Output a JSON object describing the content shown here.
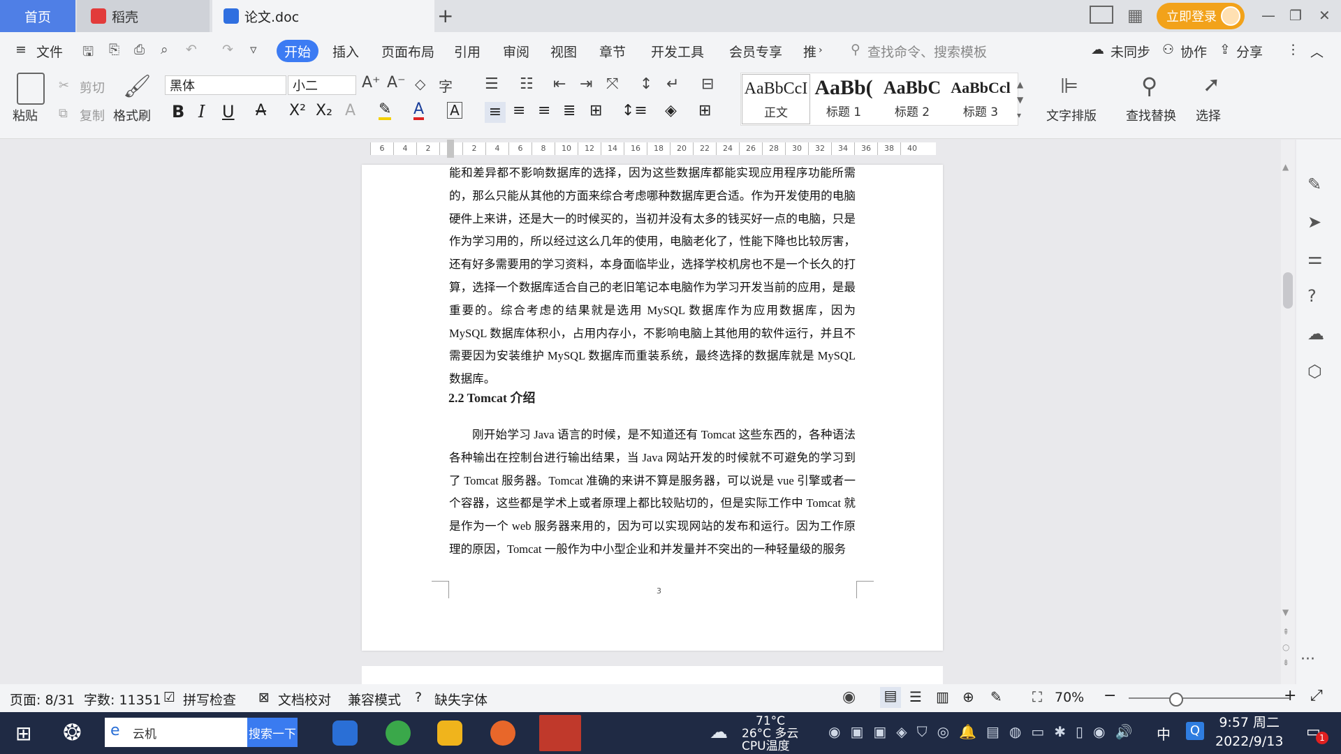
{
  "tabs": {
    "home": "首页",
    "daoke": "稻壳",
    "doc": "论文.doc",
    "plus": "+"
  },
  "window": {
    "login": "立即登录"
  },
  "menubar": {
    "file": "文件",
    "start": "开始",
    "insert": "插入",
    "layout": "页面布局",
    "ref": "引用",
    "review": "审阅",
    "view": "视图",
    "chapter": "章节",
    "devtools": "开发工具",
    "vip": "会员专享",
    "more": "推",
    "search_placeholder": "查找命令、搜索模板",
    "unsync": "未同步",
    "collab": "协作",
    "share": "分享"
  },
  "ribbon": {
    "paste": "粘贴",
    "cut": "剪切",
    "copy": "复制",
    "format_painter": "格式刷",
    "font_name": "黑体",
    "font_size": "小二",
    "styles": [
      {
        "sample": "AaBbCcI",
        "name": "正文"
      },
      {
        "sample": "AaBb(",
        "name": "标题 1"
      },
      {
        "sample": "AaBbC",
        "name": "标题 2"
      },
      {
        "sample": "AaBbCcl",
        "name": "标题 3"
      }
    ],
    "text_layout": "文字排版",
    "find_replace": "查找替换",
    "select": "选择"
  },
  "ruler": {
    "ticks": [
      "6",
      "4",
      "2",
      "",
      "2",
      "4",
      "6",
      "8",
      "10",
      "12",
      "14",
      "16",
      "18",
      "20",
      "22",
      "24",
      "26",
      "28",
      "30",
      "32",
      "34",
      "36",
      "38",
      "40"
    ]
  },
  "document": {
    "para1": "能和差异都不影响数据库的选择，因为这些数据库都能实现应用程序功能所需的，那么只能从其他的方面来综合考虑哪种数据库更合适。作为开发使用的电脑硬件上来讲，还是大一的时候买的，当初并没有太多的钱买好一点的电脑，只是作为学习用的，所以经过这么几年的使用，电脑老化了，性能下降也比较厉害，还有好多需要用的学习资料，本身面临毕业，选择学校机房也不是一个长久的打算，选择一个数据库适合自己的老旧笔记本电脑作为学习开发当前的应用，是最重要的。综合考虑的结果就是选用 MySQL 数据库作为应用数据库，因为 MySQL 数据库体积小，占用内存小，不影响电脑上其他用的软件运行，并且不需要因为安装维护 MySQL 数据库而重装系统，最终选择的数据库就是 MySQL 数据库。",
    "heading": "2.2 Tomcat 介绍",
    "para2": "刚开始学习 Java 语言的时候，是不知道还有 Tomcat 这些东西的，各种语法各种输出在控制台进行输出结果，当 Java 网站开发的时候就不可避免的学习到了 Tomcat 服务器。Tomcat 准确的来讲不算是服务器，可以说是 vue 引擎或者一个容器，这些都是学术上或者原理上都比较贴切的，但是实际工作中 Tomcat 就是作为一个 web 服务器来用的，因为可以实现网站的发布和运行。因为工作原理的原因，Tomcat 一般作为中小型企业和并发量并不突出的一种轻量级的服务",
    "page_number": "3"
  },
  "status": {
    "page": "页面: 8/31",
    "words": "字数: 11351",
    "spell": "拼写检查",
    "proof": "文档校对",
    "compat": "兼容模式",
    "missing_font": "缺失字体",
    "zoom": "70%"
  },
  "taskbar": {
    "search_text": "云机",
    "search_btn": "搜索一下",
    "weather": "26°C 多云",
    "cpu_temp": "71°C",
    "cpu_label": "CPU温度",
    "ime": "中",
    "time": "9:57 周二",
    "date": "2022/9/13",
    "notify_count": "1"
  },
  "colors": {
    "accent": "#3c7bf3",
    "login": "#f2a21a",
    "home_tab": "#4f7fe6",
    "taskbar": "#1f2a44"
  }
}
